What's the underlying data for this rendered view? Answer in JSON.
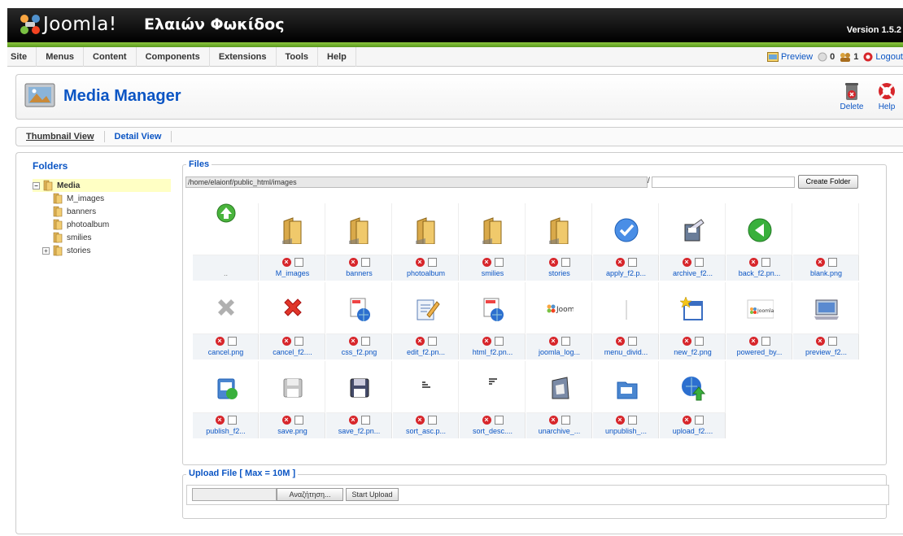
{
  "header": {
    "logo_text": "Joomla!",
    "site_name": "Ελαιών Φωκίδος",
    "version": "Version 1.5.2"
  },
  "menu": {
    "items": [
      "Site",
      "Menus",
      "Content",
      "Components",
      "Extensions",
      "Tools",
      "Help"
    ],
    "preview": "Preview",
    "messages_count": "0",
    "users_count": "1",
    "logout": "Logout"
  },
  "toolbar": {
    "title": "Media Manager",
    "delete_label": "Delete",
    "help_label": "Help"
  },
  "tabs": {
    "thumbnail": "Thumbnail View",
    "detail": "Detail View"
  },
  "folders": {
    "title": "Folders",
    "root": "Media",
    "items": [
      "M_images",
      "banners",
      "photoalbum",
      "smilies",
      "stories"
    ]
  },
  "files": {
    "legend": "Files",
    "path": "/home/elaionf/public_html/images",
    "slash": "/",
    "create_folder": "Create Folder",
    "items": [
      {
        "name": "..",
        "icon": "up-arrow-icon"
      },
      {
        "name": "M_images",
        "icon": "folder-icon"
      },
      {
        "name": "banners",
        "icon": "folder-icon"
      },
      {
        "name": "photoalbum",
        "icon": "folder-icon"
      },
      {
        "name": "smilies",
        "icon": "folder-icon"
      },
      {
        "name": "stories",
        "icon": "folder-icon"
      },
      {
        "name": "apply_f2.p...",
        "icon": "apply-icon"
      },
      {
        "name": "archive_f2...",
        "icon": "archive-icon"
      },
      {
        "name": "back_f2.pn...",
        "icon": "back-icon"
      },
      {
        "name": "blank.png",
        "icon": "blank-icon"
      },
      {
        "name": "cancel.png",
        "icon": "cancel-gray-icon"
      },
      {
        "name": "cancel_f2....",
        "icon": "cancel-red-icon"
      },
      {
        "name": "css_f2.png",
        "icon": "css-icon"
      },
      {
        "name": "edit_f2.pn...",
        "icon": "edit-icon"
      },
      {
        "name": "html_f2.pn...",
        "icon": "html-icon"
      },
      {
        "name": "joomla_log...",
        "icon": "joomla-logo-icon"
      },
      {
        "name": "menu_divid...",
        "icon": "menu-divider-icon"
      },
      {
        "name": "new_f2.png",
        "icon": "new-icon"
      },
      {
        "name": "powered_by...",
        "icon": "powered-by-icon"
      },
      {
        "name": "preview_f2...",
        "icon": "preview-icon"
      },
      {
        "name": "publish_f2...",
        "icon": "publish-icon"
      },
      {
        "name": "save.png",
        "icon": "save-gray-icon"
      },
      {
        "name": "save_f2.pn...",
        "icon": "save-icon"
      },
      {
        "name": "sort_asc.p...",
        "icon": "sort-asc-icon"
      },
      {
        "name": "sort_desc....",
        "icon": "sort-desc-icon"
      },
      {
        "name": "unarchive_...",
        "icon": "unarchive-icon"
      },
      {
        "name": "unpublish_...",
        "icon": "unpublish-icon"
      },
      {
        "name": "upload_f2....",
        "icon": "upload-icon"
      }
    ]
  },
  "upload": {
    "legend": "Upload File [ Max = 10M ]",
    "browse": "Αναζήτηση...",
    "start": "Start Upload"
  },
  "colors": {
    "link": "#0b55c4",
    "header_bg": "#000000",
    "green_bar": "#8cc63f",
    "folder_selected": "#ffffc4"
  }
}
